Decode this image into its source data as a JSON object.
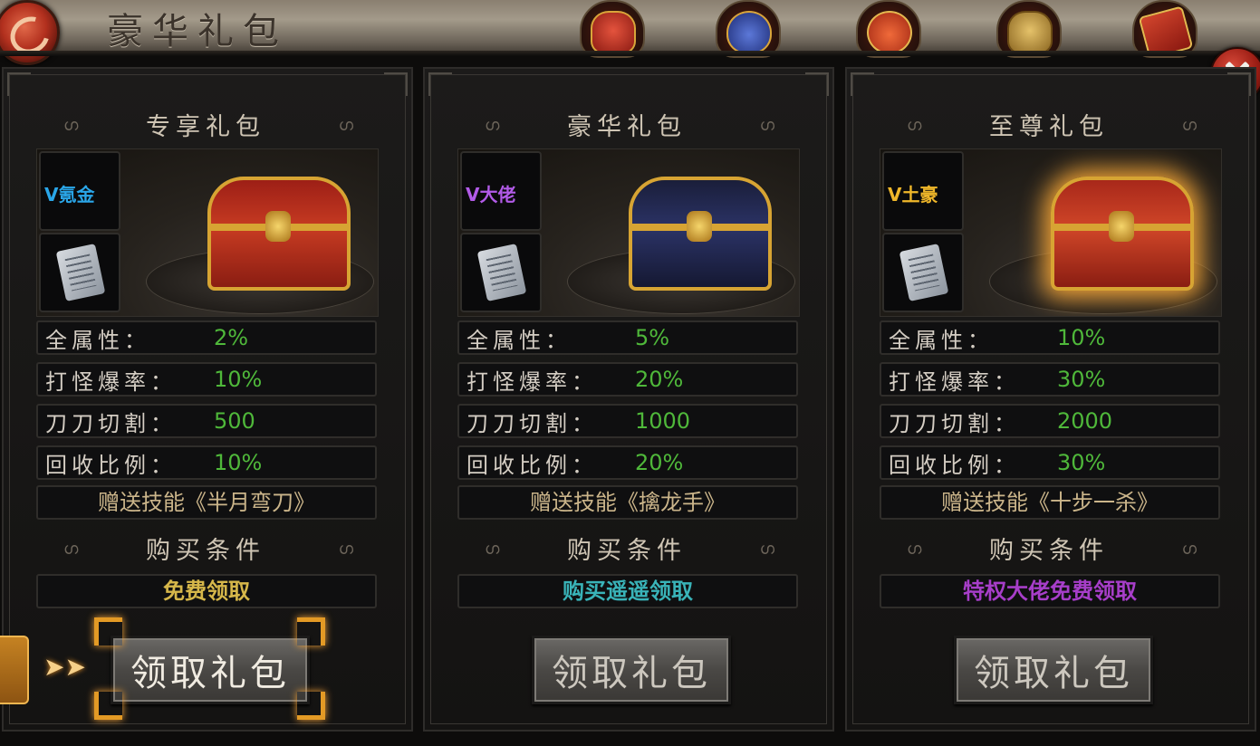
{
  "window": {
    "title": "豪华礼包"
  },
  "top_icons": [
    "red-gift-box-icon",
    "blue-pouch-icon",
    "red-lucky-bag-icon",
    "golden-lion-icon",
    "red-envelope-icon"
  ],
  "colors": {
    "value_green": "#4fb83a",
    "free_yellow": "#d6b74a",
    "buy_cyan": "#39b3b8",
    "vip_purple": "#a73ec9",
    "selection_orange": "#e39a25"
  },
  "packs": [
    {
      "title": "专享礼包",
      "vip_badge": "氪金",
      "vip_color": "#2aa6e8",
      "chest_theme": "red-gold",
      "stats": [
        {
          "label": "全属性：",
          "value": "2%"
        },
        {
          "label": "打怪爆率：",
          "value": "10%"
        },
        {
          "label": "刀刀切割：",
          "value": "500"
        },
        {
          "label": "回收比例：",
          "value": "10%"
        }
      ],
      "skill": "赠送技能《半月弯刀》",
      "condition_header": "购买条件",
      "condition": "免费领取",
      "button": "领取礼包",
      "selected": true
    },
    {
      "title": "豪华礼包",
      "vip_badge": "大佬",
      "vip_color": "#b25be8",
      "chest_theme": "navy-gold",
      "stats": [
        {
          "label": "全属性：",
          "value": "5%"
        },
        {
          "label": "打怪爆率：",
          "value": "20%"
        },
        {
          "label": "刀刀切割：",
          "value": "1000"
        },
        {
          "label": "回收比例：",
          "value": "20%"
        }
      ],
      "skill": "赠送技能《擒龙手》",
      "condition_header": "购买条件",
      "condition": "购买遥遥领取",
      "button": "领取礼包",
      "selected": false
    },
    {
      "title": "至尊礼包",
      "vip_badge": "土豪",
      "vip_color": "#f0b72a",
      "chest_theme": "glowing-red-gold",
      "stats": [
        {
          "label": "全属性：",
          "value": "10%"
        },
        {
          "label": "打怪爆率：",
          "value": "30%"
        },
        {
          "label": "刀刀切割：",
          "value": "2000"
        },
        {
          "label": "回收比例：",
          "value": "30%"
        }
      ],
      "skill": "赠送技能《十步一杀》",
      "condition_header": "购买条件",
      "condition": "特权大佬免费领取",
      "button": "领取礼包",
      "selected": false
    }
  ]
}
